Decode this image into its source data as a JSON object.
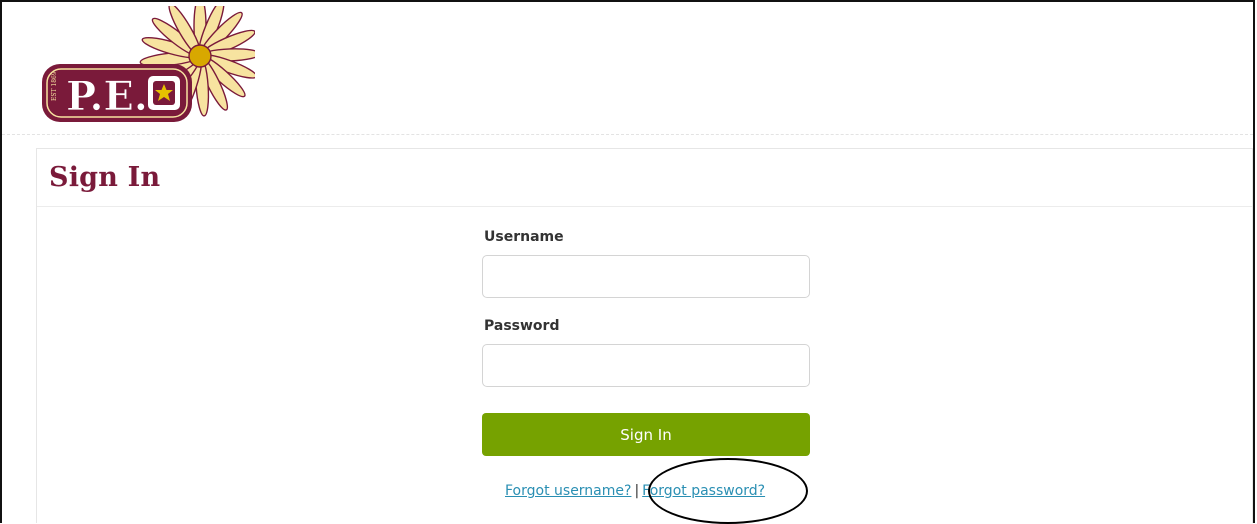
{
  "brand": {
    "logo_name": "P.E.O",
    "est": "EST. 1869",
    "colors": {
      "maroon": "#7a1a3a",
      "gold": "#e6c200",
      "petal": "#f7e3a0"
    }
  },
  "panel": {
    "title": "Sign In"
  },
  "form": {
    "username_label": "Username",
    "username_value": "",
    "password_label": "Password",
    "password_value": "",
    "submit_label": "Sign In",
    "submit_color": "#76a200"
  },
  "links": {
    "forgot_username": "Forgot username?",
    "separator": "|",
    "forgot_password": "Forgot password?",
    "link_color": "#2a8fb3"
  },
  "annotation": {
    "highlight": "circle around Forgot password?"
  }
}
